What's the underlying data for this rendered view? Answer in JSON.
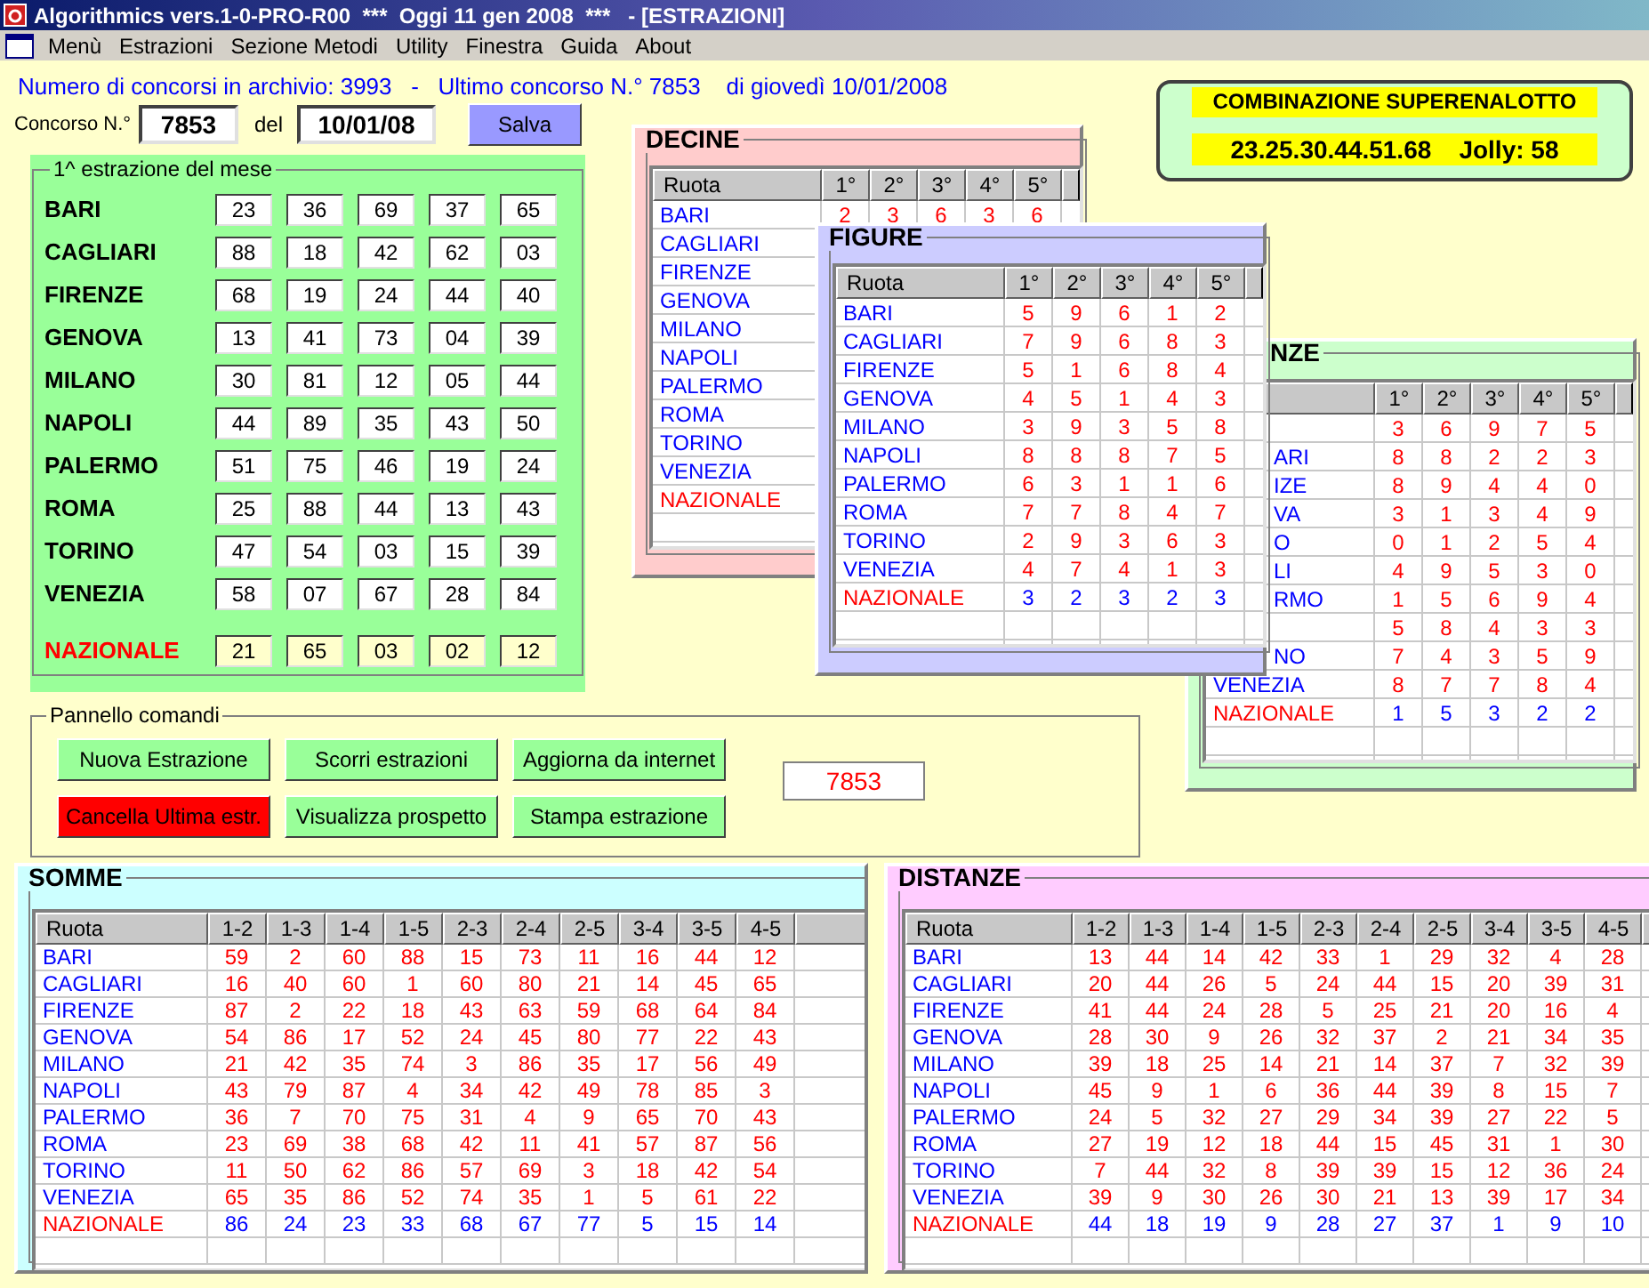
{
  "window": {
    "title": "Algorithmics vers.1-0-PRO-R00  ***  Oggi 11 gen 2008  ***   - [ESTRAZIONI]"
  },
  "menu": [
    "Menù",
    "Estrazioni",
    "Sezione Metodi",
    "Utility",
    "Finestra",
    "Guida",
    "About"
  ],
  "archive_info": "Numero di concorsi in archivio: 3993   -   Ultimo concorso N.° 7853    di giovedì 10/01/2008",
  "concorso": {
    "label": "Concorso N.°",
    "number": "7853",
    "date_label": "del",
    "date": "10/01/08",
    "save_button": "Salva"
  },
  "estrazione": {
    "title": "1^  estrazione del mese",
    "rows": [
      {
        "name": "BARI",
        "kind": "ruota",
        "numbers": [
          "23",
          "36",
          "69",
          "37",
          "65"
        ]
      },
      {
        "name": "CAGLIARI",
        "kind": "ruota",
        "numbers": [
          "88",
          "18",
          "42",
          "62",
          "03"
        ]
      },
      {
        "name": "FIRENZE",
        "kind": "ruota",
        "numbers": [
          "68",
          "19",
          "24",
          "44",
          "40"
        ]
      },
      {
        "name": "GENOVA",
        "kind": "ruota",
        "numbers": [
          "13",
          "41",
          "73",
          "04",
          "39"
        ]
      },
      {
        "name": "MILANO",
        "kind": "ruota",
        "numbers": [
          "30",
          "81",
          "12",
          "05",
          "44"
        ]
      },
      {
        "name": "NAPOLI",
        "kind": "ruota",
        "numbers": [
          "44",
          "89",
          "35",
          "43",
          "50"
        ]
      },
      {
        "name": "PALERMO",
        "kind": "ruota",
        "numbers": [
          "51",
          "75",
          "46",
          "19",
          "24"
        ]
      },
      {
        "name": "ROMA",
        "kind": "ruota",
        "numbers": [
          "25",
          "88",
          "44",
          "13",
          "43"
        ]
      },
      {
        "name": "TORINO",
        "kind": "ruota",
        "numbers": [
          "47",
          "54",
          "03",
          "15",
          "39"
        ]
      },
      {
        "name": "VENEZIA",
        "kind": "ruota",
        "numbers": [
          "58",
          "07",
          "67",
          "28",
          "84"
        ]
      },
      {
        "name": "NAZIONALE",
        "kind": "nazionale",
        "numbers": [
          "21",
          "65",
          "03",
          "02",
          "12"
        ]
      }
    ]
  },
  "commands": {
    "title": "Pannello comandi",
    "buttons": [
      {
        "label": "Nuova Estrazione",
        "kind": "normal"
      },
      {
        "label": "Scorri estrazioni",
        "kind": "normal"
      },
      {
        "label": "Aggiorna da internet",
        "kind": "normal"
      },
      {
        "label": "Cancella Ultima estr.",
        "kind": "danger"
      },
      {
        "label": "Visualizza prospetto",
        "kind": "normal"
      },
      {
        "label": "Stampa estrazione",
        "kind": "normal"
      }
    ],
    "display": "7853"
  },
  "superenalotto": {
    "title": "COMBINAZIONE SUPERENALOTTO",
    "combination": "23.25.30.44.51.68    Jolly: 58"
  },
  "windows": [
    {
      "title": "DECINE",
      "name_column": "Ruota",
      "columns": [
        "1°",
        "2°",
        "3°",
        "4°",
        "5°"
      ],
      "rows": [
        {
          "name": "BARI",
          "kind": "ruota",
          "values": [
            "2",
            "3",
            "6",
            "3",
            "6"
          ]
        },
        {
          "name": "CAGLIARI",
          "kind": "ruota"
        },
        {
          "name": "FIRENZE",
          "kind": "ruota"
        },
        {
          "name": "GENOVA",
          "kind": "ruota"
        },
        {
          "name": "MILANO",
          "kind": "ruota"
        },
        {
          "name": "NAPOLI",
          "kind": "ruota"
        },
        {
          "name": "PALERMO",
          "kind": "ruota"
        },
        {
          "name": "ROMA",
          "kind": "ruota"
        },
        {
          "name": "TORINO",
          "kind": "ruota"
        },
        {
          "name": "VENEZIA",
          "kind": "ruota"
        },
        {
          "name": "NAZIONALE",
          "kind": "nazionale"
        }
      ]
    },
    {
      "title": "FIGURE",
      "name_column": "Ruota",
      "columns": [
        "1°",
        "2°",
        "3°",
        "4°",
        "5°"
      ],
      "rows": [
        {
          "name": "BARI",
          "kind": "ruota",
          "values": [
            "5",
            "9",
            "6",
            "1",
            "2"
          ]
        },
        {
          "name": "CAGLIARI",
          "kind": "ruota",
          "values": [
            "7",
            "9",
            "6",
            "8",
            "3"
          ]
        },
        {
          "name": "FIRENZE",
          "kind": "ruota",
          "values": [
            "5",
            "1",
            "6",
            "8",
            "4"
          ]
        },
        {
          "name": "GENOVA",
          "kind": "ruota",
          "values": [
            "4",
            "5",
            "1",
            "4",
            "3"
          ]
        },
        {
          "name": "MILANO",
          "kind": "ruota",
          "values": [
            "3",
            "9",
            "3",
            "5",
            "8"
          ]
        },
        {
          "name": "NAPOLI",
          "kind": "ruota",
          "values": [
            "8",
            "8",
            "8",
            "7",
            "5"
          ]
        },
        {
          "name": "PALERMO",
          "kind": "ruota",
          "values": [
            "6",
            "3",
            "1",
            "1",
            "6"
          ]
        },
        {
          "name": "ROMA",
          "kind": "ruota",
          "values": [
            "7",
            "7",
            "8",
            "4",
            "7"
          ]
        },
        {
          "name": "TORINO",
          "kind": "ruota",
          "values": [
            "2",
            "9",
            "3",
            "6",
            "3"
          ]
        },
        {
          "name": "VENEZIA",
          "kind": "ruota",
          "values": [
            "4",
            "7",
            "4",
            "1",
            "3"
          ]
        },
        {
          "name": "NAZIONALE",
          "kind": "nazionale",
          "values": [
            "3",
            "2",
            "3",
            "2",
            "3"
          ]
        }
      ]
    },
    {
      "title": "NZE",
      "title_clipped": true,
      "columns": [
        "1°",
        "2°",
        "3°",
        "4°",
        "5°"
      ],
      "rows": [
        {
          "kind": "ruota",
          "values": [
            "3",
            "6",
            "9",
            "7",
            "5"
          ]
        },
        {
          "name": "ARI",
          "clipped": true,
          "kind": "ruota",
          "values": [
            "8",
            "8",
            "2",
            "2",
            "3"
          ]
        },
        {
          "name": "IZE",
          "clipped": true,
          "kind": "ruota",
          "values": [
            "8",
            "9",
            "4",
            "4",
            "0"
          ]
        },
        {
          "name": "VA",
          "clipped": true,
          "kind": "ruota",
          "values": [
            "3",
            "1",
            "3",
            "4",
            "9"
          ]
        },
        {
          "name": "O",
          "clipped": true,
          "kind": "ruota",
          "values": [
            "0",
            "1",
            "2",
            "5",
            "4"
          ]
        },
        {
          "name": "LI",
          "clipped": true,
          "kind": "ruota",
          "values": [
            "4",
            "9",
            "5",
            "3",
            "0"
          ]
        },
        {
          "name": "RMO",
          "clipped": true,
          "kind": "ruota",
          "values": [
            "1",
            "5",
            "6",
            "9",
            "4"
          ]
        },
        {
          "kind": "ruota",
          "values": [
            "5",
            "8",
            "4",
            "3",
            "3"
          ]
        },
        {
          "name": "NO",
          "clipped": true,
          "kind": "ruota",
          "values": [
            "7",
            "4",
            "3",
            "5",
            "9"
          ]
        },
        {
          "name": "VENEZIA",
          "kind": "ruota",
          "values": [
            "8",
            "7",
            "7",
            "8",
            "4"
          ]
        },
        {
          "name": "NAZIONALE",
          "kind": "nazionale",
          "values": [
            "1",
            "5",
            "3",
            "2",
            "2"
          ]
        }
      ]
    }
  ],
  "somme": {
    "title": "SOMME",
    "name_column": "Ruota",
    "columns": [
      "1-2",
      "1-3",
      "1-4",
      "1-5",
      "2-3",
      "2-4",
      "2-5",
      "3-4",
      "3-5",
      "4-5"
    ],
    "rows": [
      {
        "name": "BARI",
        "kind": "ruota",
        "values": [
          "59",
          "2",
          "60",
          "88",
          "15",
          "73",
          "11",
          "16",
          "44",
          "12"
        ]
      },
      {
        "name": "CAGLIARI",
        "kind": "ruota",
        "values": [
          "16",
          "40",
          "60",
          "1",
          "60",
          "80",
          "21",
          "14",
          "45",
          "65"
        ]
      },
      {
        "name": "FIRENZE",
        "kind": "ruota",
        "values": [
          "87",
          "2",
          "22",
          "18",
          "43",
          "63",
          "59",
          "68",
          "64",
          "84"
        ]
      },
      {
        "name": "GENOVA",
        "kind": "ruota",
        "values": [
          "54",
          "86",
          "17",
          "52",
          "24",
          "45",
          "80",
          "77",
          "22",
          "43"
        ]
      },
      {
        "name": "MILANO",
        "kind": "ruota",
        "values": [
          "21",
          "42",
          "35",
          "74",
          "3",
          "86",
          "35",
          "17",
          "56",
          "49"
        ]
      },
      {
        "name": "NAPOLI",
        "kind": "ruota",
        "values": [
          "43",
          "79",
          "87",
          "4",
          "34",
          "42",
          "49",
          "78",
          "85",
          "3"
        ]
      },
      {
        "name": "PALERMO",
        "kind": "ruota",
        "values": [
          "36",
          "7",
          "70",
          "75",
          "31",
          "4",
          "9",
          "65",
          "70",
          "43"
        ]
      },
      {
        "name": "ROMA",
        "kind": "ruota",
        "values": [
          "23",
          "69",
          "38",
          "68",
          "42",
          "11",
          "41",
          "57",
          "87",
          "56"
        ]
      },
      {
        "name": "TORINO",
        "kind": "ruota",
        "values": [
          "11",
          "50",
          "62",
          "86",
          "57",
          "69",
          "3",
          "18",
          "42",
          "54"
        ]
      },
      {
        "name": "VENEZIA",
        "kind": "ruota",
        "values": [
          "65",
          "35",
          "86",
          "52",
          "74",
          "35",
          "1",
          "5",
          "61",
          "22"
        ]
      },
      {
        "name": "NAZIONALE",
        "kind": "nazionale",
        "values": [
          "86",
          "24",
          "23",
          "33",
          "68",
          "67",
          "77",
          "5",
          "15",
          "14"
        ]
      }
    ]
  },
  "distanze": {
    "title": "DISTANZE",
    "name_column": "Ruota",
    "columns": [
      "1-2",
      "1-3",
      "1-4",
      "1-5",
      "2-3",
      "2-4",
      "2-5",
      "3-4",
      "3-5",
      "4-5"
    ],
    "rows": [
      {
        "name": "BARI",
        "kind": "ruota",
        "values": [
          "13",
          "44",
          "14",
          "42",
          "33",
          "1",
          "29",
          "32",
          "4",
          "28"
        ]
      },
      {
        "name": "CAGLIARI",
        "kind": "ruota",
        "values": [
          "20",
          "44",
          "26",
          "5",
          "24",
          "44",
          "15",
          "20",
          "39",
          "31"
        ]
      },
      {
        "name": "FIRENZE",
        "kind": "ruota",
        "values": [
          "41",
          "44",
          "24",
          "28",
          "5",
          "25",
          "21",
          "20",
          "16",
          "4"
        ]
      },
      {
        "name": "GENOVA",
        "kind": "ruota",
        "values": [
          "28",
          "30",
          "9",
          "26",
          "32",
          "37",
          "2",
          "21",
          "34",
          "35"
        ]
      },
      {
        "name": "MILANO",
        "kind": "ruota",
        "values": [
          "39",
          "18",
          "25",
          "14",
          "21",
          "14",
          "37",
          "7",
          "32",
          "39"
        ]
      },
      {
        "name": "NAPOLI",
        "kind": "ruota",
        "values": [
          "45",
          "9",
          "1",
          "6",
          "36",
          "44",
          "39",
          "8",
          "15",
          "7"
        ]
      },
      {
        "name": "PALERMO",
        "kind": "ruota",
        "values": [
          "24",
          "5",
          "32",
          "27",
          "29",
          "34",
          "39",
          "27",
          "22",
          "5"
        ]
      },
      {
        "name": "ROMA",
        "kind": "ruota",
        "values": [
          "27",
          "19",
          "12",
          "18",
          "44",
          "15",
          "45",
          "31",
          "1",
          "30"
        ]
      },
      {
        "name": "TORINO",
        "kind": "ruota",
        "values": [
          "7",
          "44",
          "32",
          "8",
          "39",
          "39",
          "15",
          "12",
          "36",
          "24"
        ]
      },
      {
        "name": "VENEZIA",
        "kind": "ruota",
        "values": [
          "39",
          "9",
          "30",
          "26",
          "30",
          "21",
          "13",
          "39",
          "17",
          "34"
        ]
      },
      {
        "name": "NAZIONALE",
        "kind": "nazionale",
        "values": [
          "44",
          "18",
          "19",
          "9",
          "28",
          "27",
          "37",
          "1",
          "9",
          "10"
        ]
      }
    ]
  }
}
